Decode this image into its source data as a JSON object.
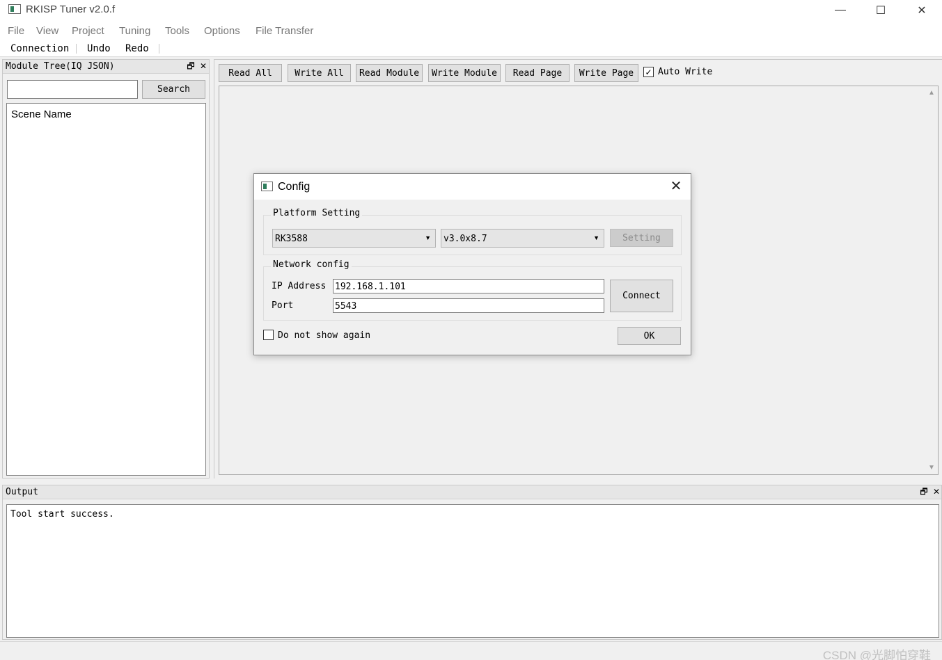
{
  "window": {
    "title": "RKISP Tuner v2.0.f",
    "minimize_glyph": "—",
    "maximize_glyph": "☐",
    "close_glyph": "✕"
  },
  "menubar": {
    "items": [
      "File",
      "View",
      "Project",
      "Tuning",
      "Tools",
      "Options",
      "File Transfer"
    ]
  },
  "toolbar": {
    "connection": "Connection",
    "undo": "Undo",
    "redo": "Redo"
  },
  "module_tree": {
    "title": "Module Tree(IQ JSON)",
    "search_value": "",
    "search_button": "Search",
    "header": "Scene Name",
    "float_glyph": "🗗",
    "close_glyph": "✕"
  },
  "main": {
    "buttons": [
      "Read All",
      "Write All",
      "Read Module",
      "Write Module",
      "Read Page",
      "Write Page"
    ],
    "auto_write_label": "Auto Write",
    "auto_write_checked": true,
    "check_glyph": "✓",
    "scroll_up_glyph": "▲",
    "scroll_down_glyph": "▼"
  },
  "output": {
    "title": "Output",
    "text": "Tool start success.",
    "float_glyph": "🗗",
    "close_glyph": "✕"
  },
  "watermark": "CSDN @光脚怕穿鞋",
  "dialog": {
    "title": "Config",
    "close_glyph": "✕",
    "platform_group": "Platform Setting",
    "platform_value": "RK3588",
    "version_value": "v3.0x8.7",
    "dropdown_glyph": "▼",
    "setting_button": "Setting",
    "network_group": "Network config",
    "ip_label": "IP Address",
    "ip_value": "192.168.1.101",
    "port_label": "Port",
    "port_value": "5543",
    "connect_button": "Connect",
    "dont_show_label": "Do not show again",
    "dont_show_checked": false,
    "ok_button": "OK"
  },
  "colors": {
    "window_bg": "#f0f0f0",
    "disabled_button_bg": "#cccccc"
  }
}
